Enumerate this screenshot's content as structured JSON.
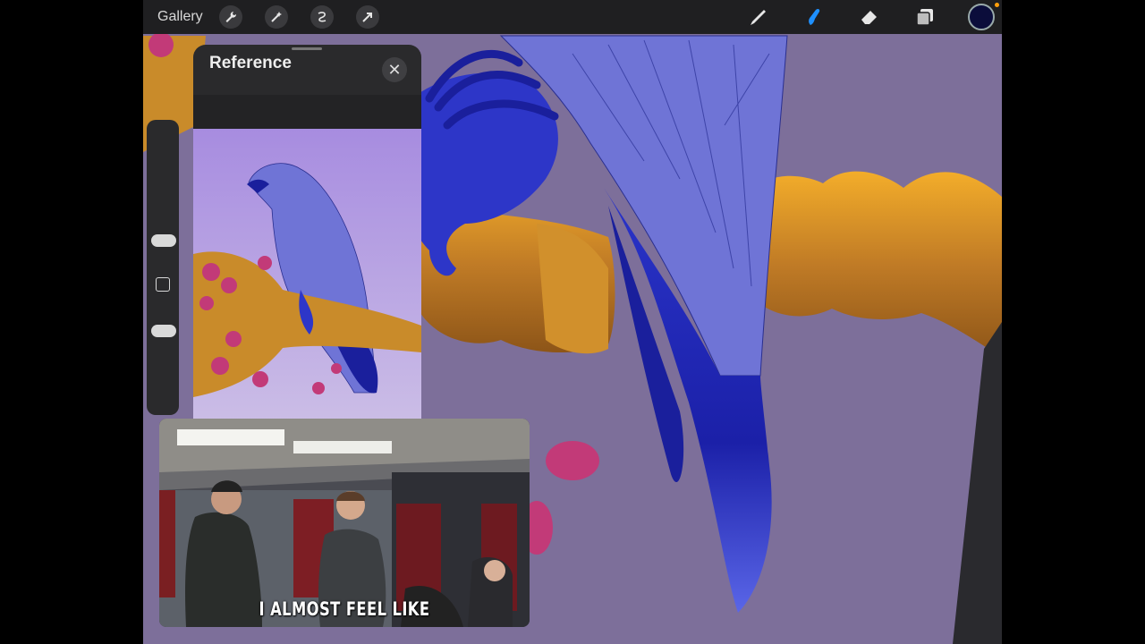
{
  "toolbar": {
    "gallery_label": "Gallery",
    "left_tools": [
      "wrench-icon",
      "magic-wand-icon",
      "selection-icon",
      "transform-arrow-icon"
    ],
    "right_tools": [
      "brush-icon",
      "smudge-icon",
      "eraser-icon",
      "layers-icon"
    ],
    "active_tool": "smudge-icon",
    "current_color": "#0b0d3b",
    "accent_color": "#1e90ff"
  },
  "sidebar": {
    "brush_size_level": 0.45,
    "opacity_level": 0.8
  },
  "reference": {
    "title": "Reference",
    "close_icon": "close-icon"
  },
  "video": {
    "caption": "I ALMOST FEEL LIKE"
  },
  "palette": {
    "canvas_bg": "#7d6f9a",
    "bird_body": "#6f74d6",
    "bird_dark": "#1a1f9c",
    "branch": "#c98b2a",
    "flowers": "#c23a78"
  }
}
